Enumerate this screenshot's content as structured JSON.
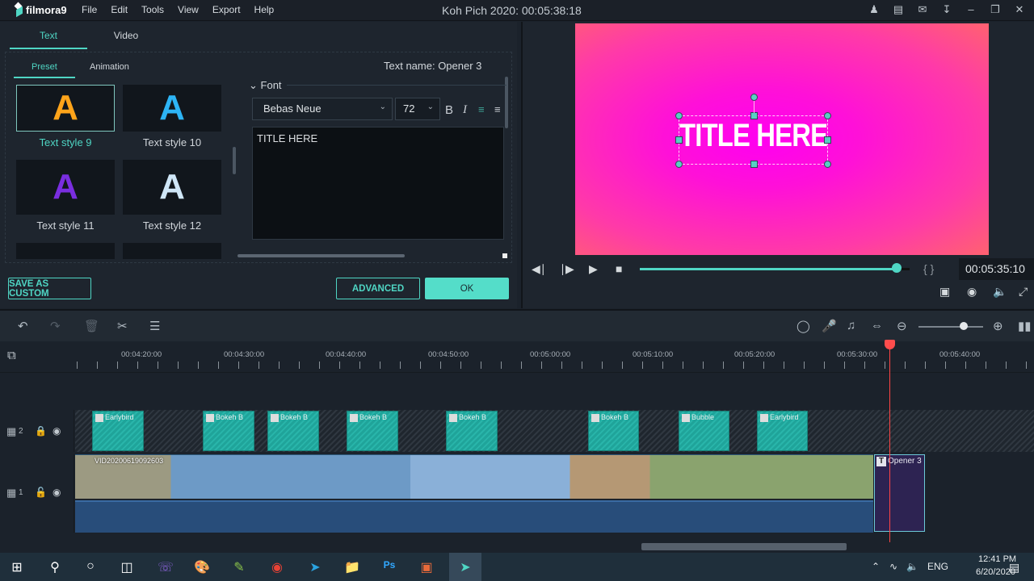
{
  "app": {
    "name": "filmora9",
    "window_title": "Koh Pich 2020: 00:05:38:18"
  },
  "menu": [
    "File",
    "Edit",
    "Tools",
    "View",
    "Export",
    "Help"
  ],
  "top_icons": [
    "account-icon",
    "save-icon",
    "mail-icon",
    "download-icon",
    "minimize-icon",
    "restore-icon",
    "close-icon"
  ],
  "left_panel": {
    "tabs": [
      {
        "label": "Text",
        "active": true
      },
      {
        "label": "Video",
        "active": false
      }
    ],
    "subtabs": [
      {
        "label": "Preset",
        "active": true
      },
      {
        "label": "Animation",
        "active": false
      }
    ],
    "text_name": "Text name: Opener 3",
    "styles": [
      {
        "label": "Text style 9",
        "color": "#ffa41a",
        "selected": true
      },
      {
        "label": "Text style 10",
        "color": "#2db4f5",
        "selected": false
      },
      {
        "label": "Text style 11",
        "color": "#7a2ee0",
        "selected": false
      },
      {
        "label": "Text style 12",
        "color": "#cfe6f7",
        "selected": false
      }
    ],
    "font_section": "Font",
    "font_family": "Bebas Neue",
    "font_size": "72",
    "bold": "B",
    "italic": "I",
    "text_content": "TITLE HERE",
    "buttons": {
      "save_custom": "SAVE AS CUSTOM",
      "advanced": "ADVANCED",
      "ok": "OK"
    }
  },
  "preview": {
    "title_text": "TITLE HERE",
    "timecode": "00:05:35:10",
    "progress": 0.97,
    "brackets": "{ }"
  },
  "timeline": {
    "ruler": [
      "00:04:20:00",
      "00:04:30:00",
      "00:04:40:00",
      "00:04:50:00",
      "00:05:00:00",
      "00:05:10:00",
      "00:05:20:00",
      "00:05:30:00",
      "00:05:40:00"
    ],
    "zoom_level": 0.7,
    "tracks": [
      {
        "number": "2",
        "locked": true,
        "visible": true
      },
      {
        "number": "1",
        "locked": false,
        "visible": true
      }
    ],
    "effects": [
      "Earlybird",
      "Bokeh B",
      "Bokeh B",
      "Bokeh B",
      "Bokeh B",
      "Bokeh B",
      "Bubble",
      "Earlybird"
    ],
    "video_clip": "VID20200619092603",
    "title_clip": "Opener 3"
  },
  "taskbar": {
    "apps": [
      "windows-start",
      "search",
      "cortana",
      "task-view",
      "viber",
      "paint",
      "notepad",
      "chrome",
      "telegram",
      "file-explorer",
      "photoshop",
      "office",
      "filmora"
    ],
    "language": "ENG",
    "time": "12:41 PM",
    "date": "6/20/2020"
  }
}
